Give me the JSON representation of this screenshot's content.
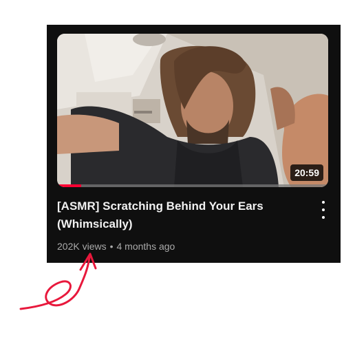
{
  "video": {
    "title": "[ASMR] Scratching Behind Your Ears (Whimsically)",
    "duration": "20:59",
    "views": "202K views",
    "separator": "•",
    "age": "4 months ago",
    "watch_progress": 0.09
  },
  "colors": {
    "card_background": "#0f0f0f",
    "progress_red": "#ff0033",
    "annotation_red": "#e8183c",
    "meta_text": "#aaaaaa"
  },
  "icons": {
    "menu": "more-vert-icon",
    "annotation": "hand-drawn-arrow"
  }
}
